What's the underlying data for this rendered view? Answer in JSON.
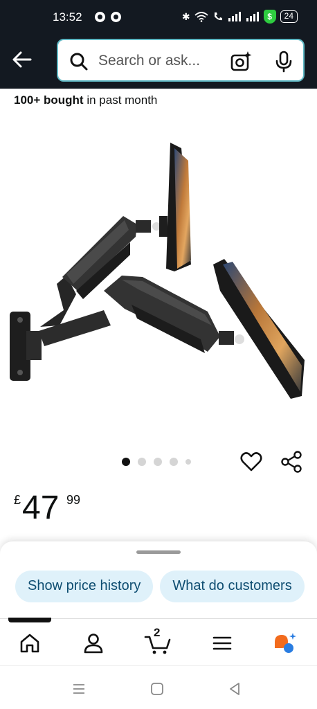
{
  "status": {
    "time": "13:52",
    "battery": "24"
  },
  "search": {
    "placeholder": "Search or ask..."
  },
  "product": {
    "bought_strong": "100+ bought",
    "bought_rest": " in past month",
    "price_currency": "£",
    "price_whole": "47",
    "price_fraction": "99",
    "image_count": 5,
    "active_image": 1
  },
  "chips": [
    "Show price history",
    "What do customers"
  ],
  "tabs": [
    "home",
    "account",
    "cart",
    "menu",
    "rufus"
  ],
  "cart": {
    "count": "2"
  },
  "colors": {
    "header": "#131921",
    "chip_bg": "#dff1fa",
    "chip_text": "#0e4d71"
  }
}
